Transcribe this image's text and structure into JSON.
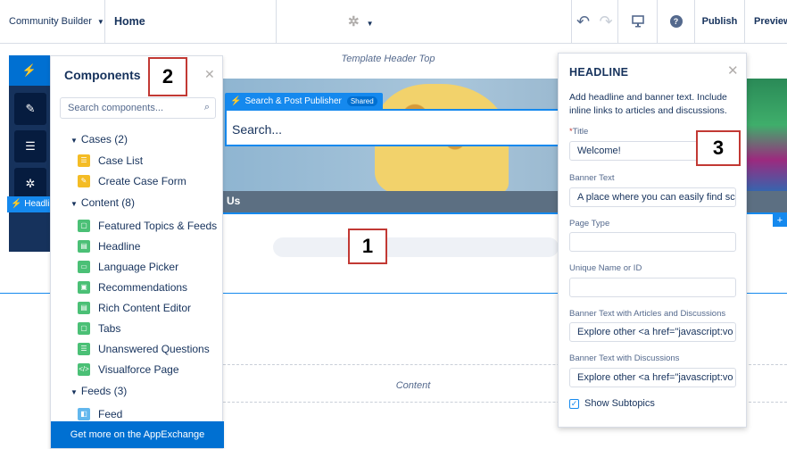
{
  "topbar": {
    "community_builder": "Community Builder",
    "home": "Home",
    "publish": "Publish",
    "preview": "Preview",
    "icons": [
      "undo-icon",
      "redo-icon",
      "device-preview-icon",
      "help-icon",
      "gear-icon"
    ]
  },
  "canvas": {
    "template_header_top": "Template Header Top",
    "search_tag": "Search & Post Publisher",
    "search_tag_shared": "Shared",
    "search_placeholder": "Search...",
    "us_bar": "Us",
    "content_label": "Content",
    "headline_tag": "Headli",
    "plus": "+"
  },
  "components": {
    "title": "Components",
    "search_placeholder": "Search components...",
    "sections": [
      {
        "label": "Cases (2)",
        "items": [
          "Case List",
          "Create Case Form"
        ]
      },
      {
        "label": "Content (8)",
        "items": [
          "Featured Topics & Feeds",
          "Headline",
          "Language Picker",
          "Recommendations",
          "Rich Content Editor",
          "Tabs",
          "Unanswered Questions",
          "Visualforce Page"
        ]
      },
      {
        "label": "Feeds (3)",
        "items": [
          "Feed"
        ]
      }
    ],
    "appexchange": "Get more on the AppExchange"
  },
  "headline_panel": {
    "title": "HEADLINE",
    "description": "Add headline and banner text. Include inline links to articles and discussions.",
    "fields": [
      {
        "label": "Title",
        "required": true,
        "value": "Welcome!"
      },
      {
        "label": "Banner Text",
        "required": false,
        "value": "A place where you can easily find sc"
      },
      {
        "label": "Page Type",
        "required": false,
        "value": ""
      },
      {
        "label": "Unique Name or ID",
        "required": false,
        "value": ""
      },
      {
        "label": "Banner Text with Articles and Discussions",
        "required": false,
        "value": "Explore other <a href=\"javascript:vo"
      },
      {
        "label": "Banner Text with Discussions",
        "required": false,
        "value": "Explore other <a href=\"javascript:vo"
      }
    ],
    "show_subtopics": "Show Subtopics",
    "show_subtopics_checked": true
  },
  "callouts": [
    "1",
    "2",
    "3"
  ],
  "colors": {
    "accent": "#1589ee",
    "brand": "#0070d2",
    "callout_border": "#c23934"
  }
}
